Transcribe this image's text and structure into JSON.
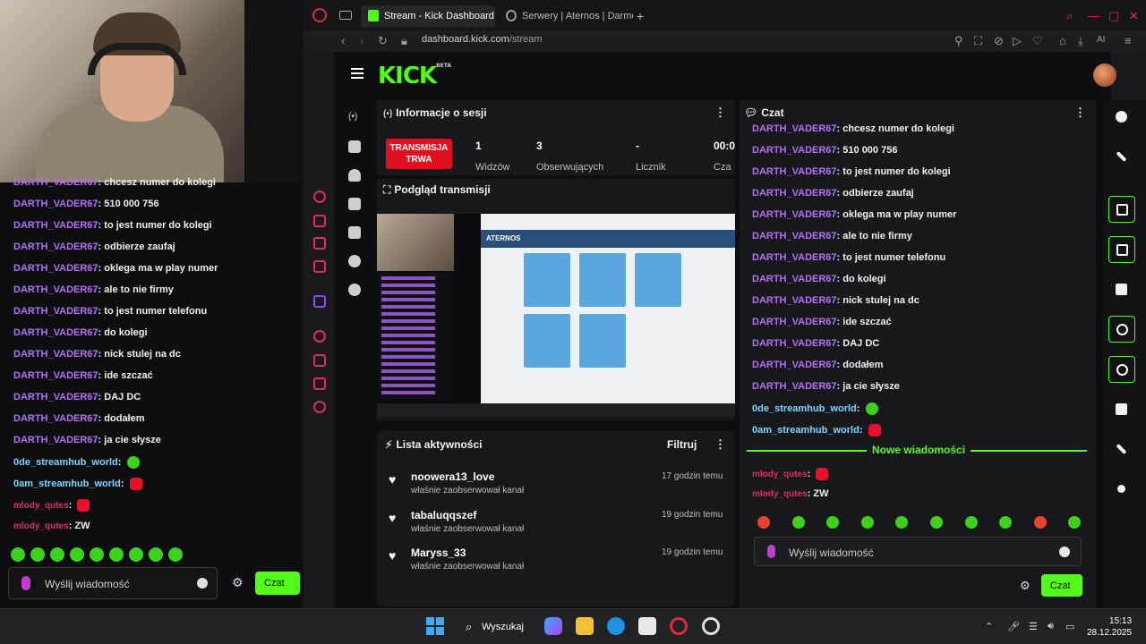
{
  "browser": {
    "tabs": [
      {
        "label": "Stream - Kick Dashboard",
        "active": true
      },
      {
        "label": "Serwery | Aternos | Darmo",
        "active": false
      }
    ],
    "url_host": "dashboard.kick.com",
    "url_path": "/stream"
  },
  "kick": {
    "logo": "KICK",
    "logo_badge": "BETA",
    "session": {
      "title": "Informacje o sesji",
      "live_badge_line1": "TRANSMISJA",
      "live_badge_line2": "TRWA",
      "stats": [
        {
          "value": "1",
          "label": "Widzów"
        },
        {
          "value": "3",
          "label": "Obserwujących"
        },
        {
          "value": "-",
          "label": "Licznik"
        },
        {
          "value": "00:0",
          "label": "Cza"
        }
      ]
    },
    "preview": {
      "title": "Podgląd transmisji",
      "inner_brand": "ATERNOS"
    },
    "activity": {
      "title": "Lista aktywności",
      "filter_label": "Filtruj",
      "items": [
        {
          "name": "noowera13_love",
          "sub": "właśnie zaobserwował kanał",
          "time": "17 godzin temu"
        },
        {
          "name": "tabaluqqszef",
          "sub": "właśnie zaobserwował kanał",
          "time": "19 godzin temu"
        },
        {
          "name": "Maryss_33",
          "sub": "właśnie zaobserwował kanał",
          "time": "19 godzin temu"
        }
      ]
    },
    "chat": {
      "title": "Czat",
      "messages": [
        {
          "user": "DARTH_VADER67",
          "text": "chcesz numer do kolegi"
        },
        {
          "user": "DARTH_VADER67",
          "text": "510 000 756"
        },
        {
          "user": "DARTH_VADER67",
          "text": "to jest numer do kolegi"
        },
        {
          "user": "DARTH_VADER67",
          "text": "odbierze zaufaj"
        },
        {
          "user": "DARTH_VADER67",
          "text": "oklega ma w play numer"
        },
        {
          "user": "DARTH_VADER67",
          "text": "ale to nie firmy"
        },
        {
          "user": "DARTH_VADER67",
          "text": "to jest numer telefonu"
        },
        {
          "user": "DARTH_VADER67",
          "text": "do kolegi"
        },
        {
          "user": "DARTH_VADER67",
          "text": "nick stulej na dc"
        },
        {
          "user": "DARTH_VADER67",
          "text": "ide szczać"
        },
        {
          "user": "DARTH_VADER67",
          "text": "DAJ DC"
        },
        {
          "user": "DARTH_VADER67",
          "text": "dodałem"
        },
        {
          "user": "DARTH_VADER67",
          "text": "ja cie słysze"
        },
        {
          "user": "0de_streamhub_world",
          "text": ""
        },
        {
          "user": "0am_streamhub_world",
          "text": ""
        }
      ],
      "new_messages_label": "Nowe wiadomości",
      "new_messages": [
        {
          "user": "mlody_qutes",
          "text": ""
        },
        {
          "user": "mlody_qutes",
          "text": "ZW"
        }
      ],
      "input_placeholder": "Wyślij wiadomość",
      "send_label": "Czat"
    }
  },
  "obs_chat": {
    "messages": [
      {
        "user": "DARTH_VADER67",
        "text": "chcesz numer do kolegi"
      },
      {
        "user": "DARTH_VADER67",
        "text": "510 000 756"
      },
      {
        "user": "DARTH_VADER67",
        "text": "to jest numer do kolegi"
      },
      {
        "user": "DARTH_VADER67",
        "text": "odbierze zaufaj"
      },
      {
        "user": "DARTH_VADER67",
        "text": "oklega ma w play numer"
      },
      {
        "user": "DARTH_VADER67",
        "text": "ale to nie firmy"
      },
      {
        "user": "DARTH_VADER67",
        "text": "to jest numer telefonu"
      },
      {
        "user": "DARTH_VADER67",
        "text": "do kolegi"
      },
      {
        "user": "DARTH_VADER67",
        "text": "nick stulej na dc"
      },
      {
        "user": "DARTH_VADER67",
        "text": "ide szczać"
      },
      {
        "user": "DARTH_VADER67",
        "text": "DAJ DC"
      },
      {
        "user": "DARTH_VADER67",
        "text": "dodałem"
      },
      {
        "user": "DARTH_VADER67",
        "text": "ja cie słysze"
      },
      {
        "user": "0de_streamhub_world",
        "text": ""
      },
      {
        "user": "0am_streamhub_world",
        "text": ""
      },
      {
        "user": "mlody_qutes",
        "text": ""
      },
      {
        "user": "mlody_qutes",
        "text": "ZW"
      }
    ],
    "input_placeholder": "Wyślij wiadomość",
    "send_label": "Czat"
  },
  "taskbar": {
    "search_label": "Wyszukaj",
    "time": "15:13",
    "date": "28.12.2025"
  },
  "colors": {
    "kick_green": "#53fc18",
    "live_red": "#e0101e",
    "username_purple": "#b46ff2"
  }
}
